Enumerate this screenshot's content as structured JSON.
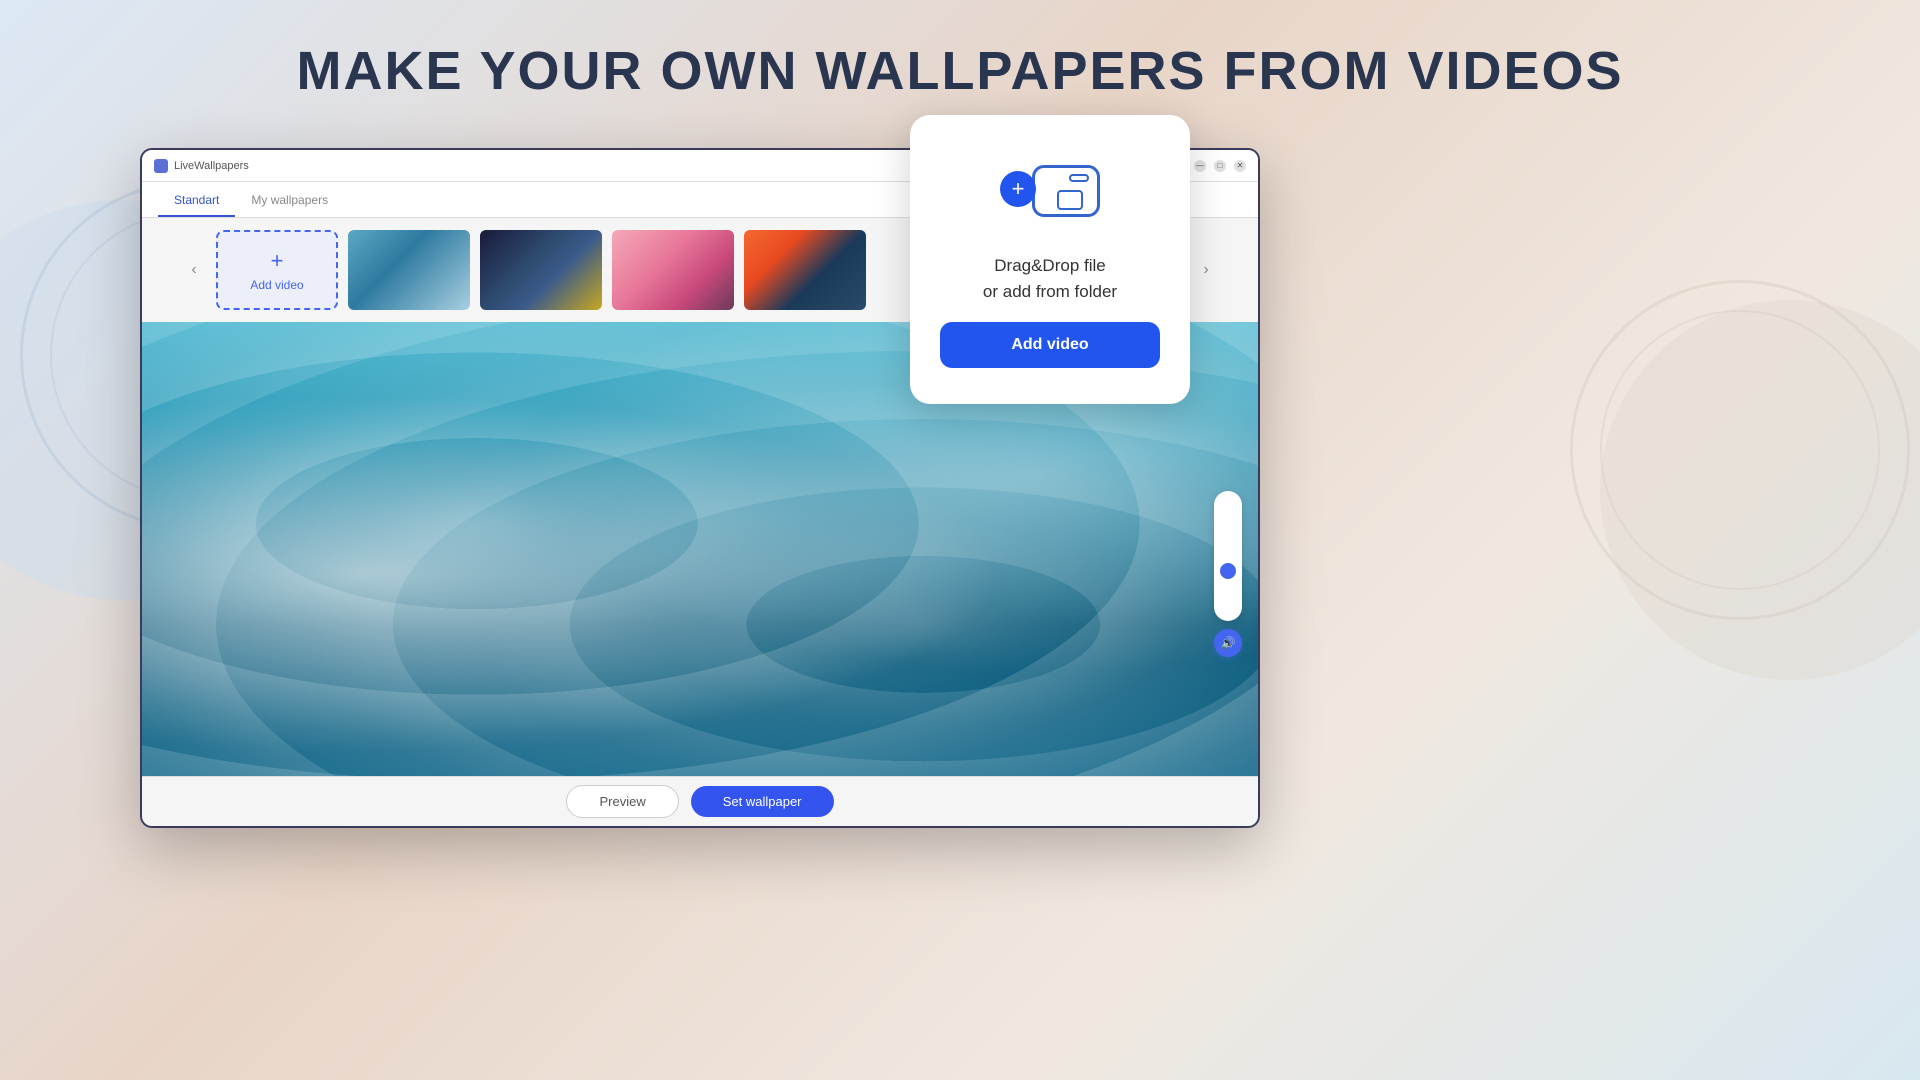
{
  "page": {
    "heading": "MAKE YOUR OWN WALLPAPERS FROM VIDEOS",
    "background_colors": {
      "start": "#dce8f5",
      "mid": "#e8d5c8",
      "end": "#d8e8f0"
    }
  },
  "app_window": {
    "title": "LiveWallpapers",
    "tabs": [
      {
        "label": "Standart",
        "active": true
      },
      {
        "label": "My wallpapers",
        "active": false
      }
    ],
    "controls": {
      "minimize": "—",
      "maximize": "□",
      "close": "✕"
    }
  },
  "carousel": {
    "add_video_label": "Add video",
    "add_video_icon": "+",
    "prev_arrow": "‹",
    "next_arrow": "›",
    "thumbnails": [
      {
        "id": "thumb-1",
        "alt": "Ocean waves aerial"
      },
      {
        "id": "thumb-2",
        "alt": "Starry night sky"
      },
      {
        "id": "thumb-3",
        "alt": "Cherry blossoms"
      },
      {
        "id": "thumb-4",
        "alt": "Sunset ocean"
      }
    ]
  },
  "bottom_bar": {
    "preview_label": "Preview",
    "set_wallpaper_label": "Set wallpaper"
  },
  "popup": {
    "drag_drop_text": "Drag&Drop file\nor add from folder",
    "add_video_label": "Add video",
    "plus_icon": "+"
  },
  "volume": {
    "icon": "🔊"
  }
}
